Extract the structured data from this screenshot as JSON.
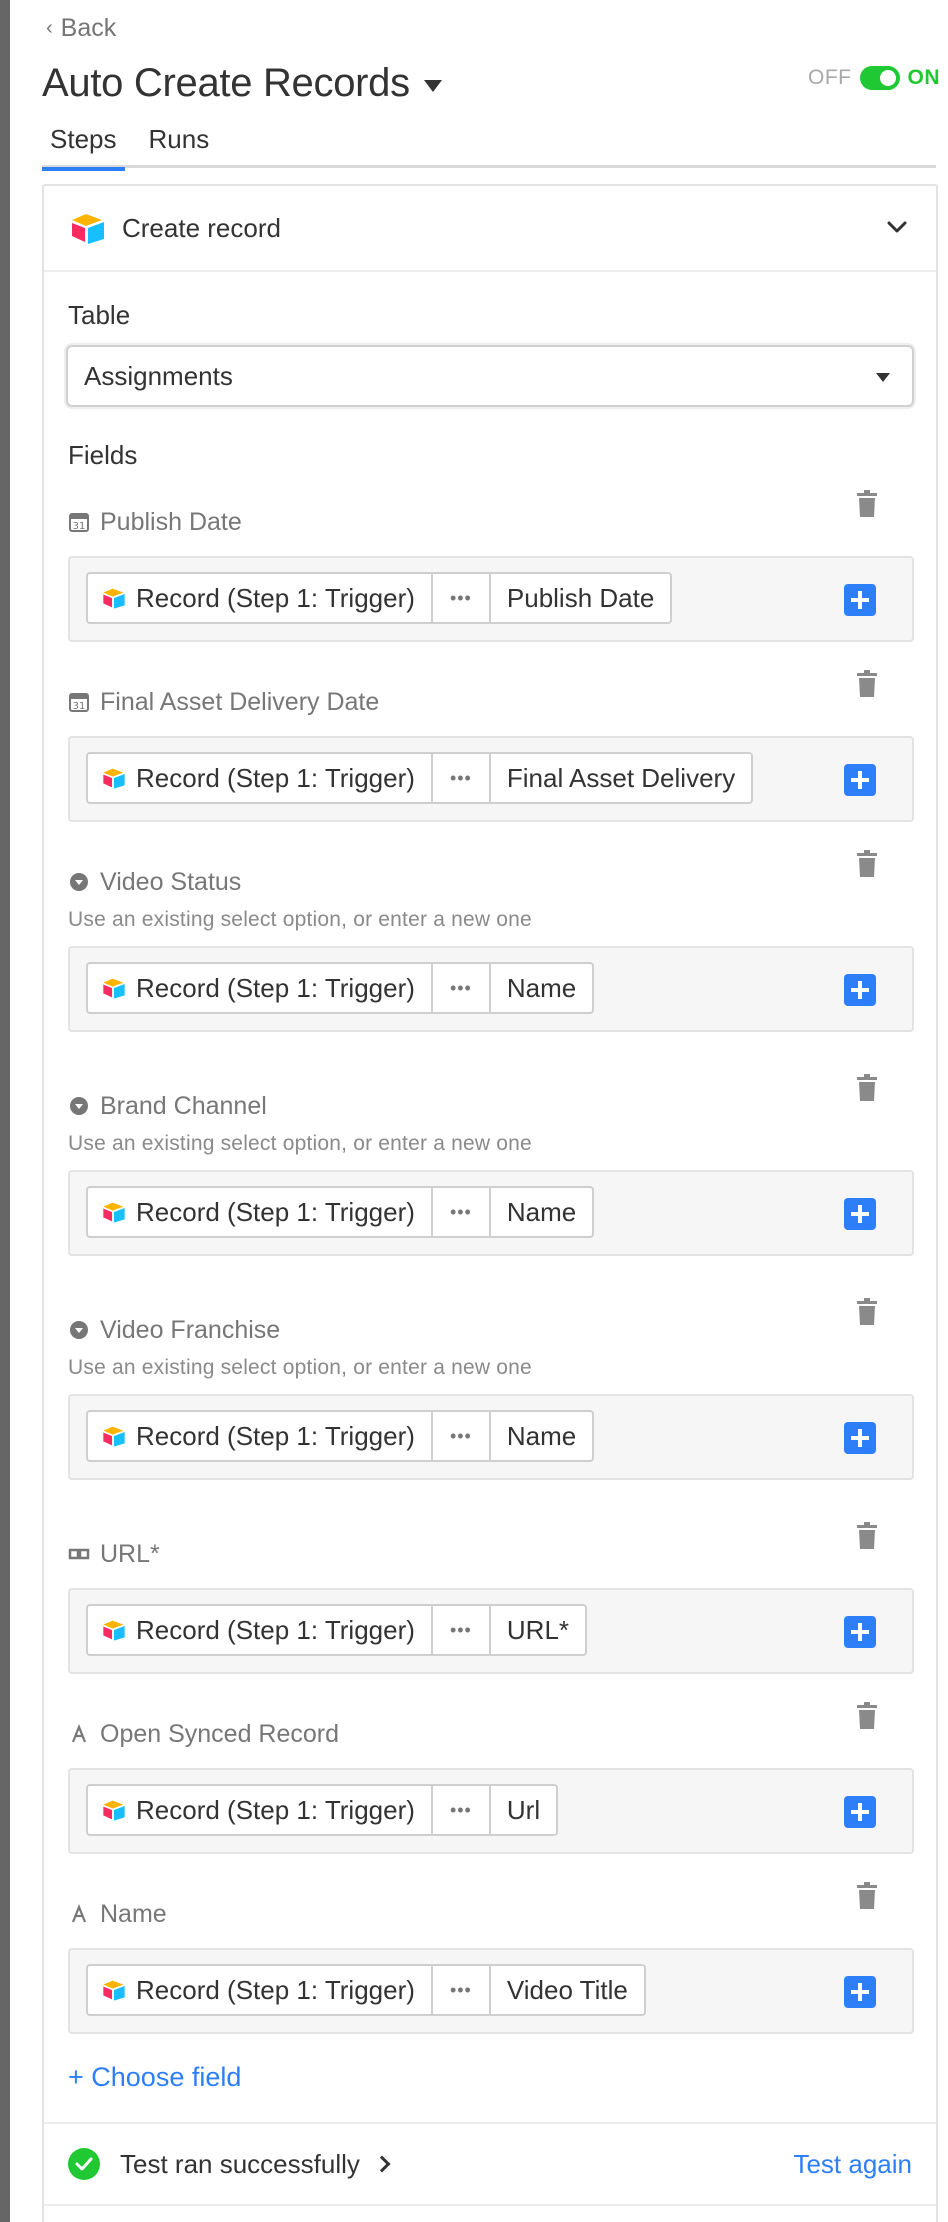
{
  "nav": {
    "back_label": "Back"
  },
  "header": {
    "title": "Auto Create Records",
    "toggle": {
      "off_label": "OFF",
      "on_label": "ON",
      "state": "on"
    }
  },
  "tabs": [
    {
      "label": "Steps",
      "active": true
    },
    {
      "label": "Runs",
      "active": false
    }
  ],
  "step": {
    "title": "Create record",
    "table_label": "Table",
    "table_value": "Assignments",
    "fields_label": "Fields",
    "fields": [
      {
        "name": "Publish Date",
        "type_icon": "calendar-icon",
        "hint": "",
        "source": "Record (Step 1: Trigger)",
        "value": "Publish Date"
      },
      {
        "name": "Final Asset Delivery Date",
        "type_icon": "calendar-icon",
        "hint": "",
        "source": "Record (Step 1: Trigger)",
        "value": "Final Asset Delivery"
      },
      {
        "name": "Video Status",
        "type_icon": "select-icon",
        "hint": "Use an existing select option, or enter a new one",
        "source": "Record (Step 1: Trigger)",
        "value": "Name"
      },
      {
        "name": "Brand Channel",
        "type_icon": "select-icon",
        "hint": "Use an existing select option, or enter a new one",
        "source": "Record (Step 1: Trigger)",
        "value": "Name"
      },
      {
        "name": "Video Franchise",
        "type_icon": "select-icon",
        "hint": "Use an existing select option, or enter a new one",
        "source": "Record (Step 1: Trigger)",
        "value": "Name"
      },
      {
        "name": "URL*",
        "type_icon": "link-icon",
        "hint": "",
        "source": "Record (Step 1: Trigger)",
        "value": "URL*"
      },
      {
        "name": "Open Synced Record",
        "type_icon": "text-icon",
        "hint": "",
        "source": "Record (Step 1: Trigger)",
        "value": "Url"
      },
      {
        "name": "Name",
        "type_icon": "text-icon",
        "hint": "",
        "source": "Record (Step 1: Trigger)",
        "value": "Video Title"
      }
    ],
    "choose_field_label": "+ Choose field"
  },
  "footer": {
    "status": "Test ran successfully",
    "test_again_label": "Test again"
  },
  "colors": {
    "accent": "#2d7ff9",
    "success": "#20c933",
    "text": "#333333",
    "muted": "#777777"
  }
}
